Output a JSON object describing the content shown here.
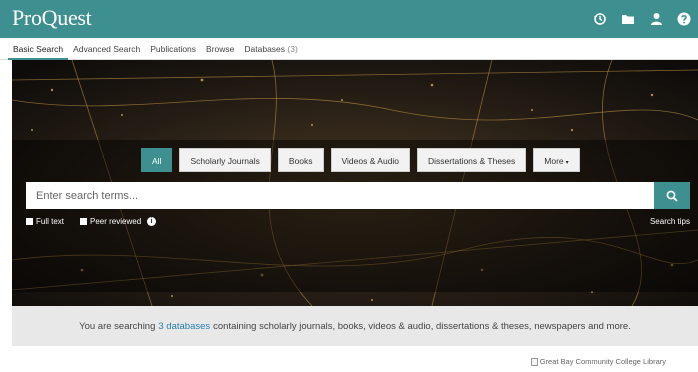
{
  "header": {
    "logo": "ProQuest",
    "icons": [
      "history-icon",
      "folder-icon",
      "user-icon",
      "help-icon"
    ]
  },
  "nav": {
    "tabs": [
      {
        "label": "Basic Search"
      },
      {
        "label": "Advanced Search"
      },
      {
        "label": "Publications"
      },
      {
        "label": "Browse"
      },
      {
        "label": "Databases",
        "count": "(3)"
      }
    ]
  },
  "filters": {
    "items": [
      "All",
      "Scholarly Journals",
      "Books",
      "Videos & Audio",
      "Dissertations & Theses",
      "More"
    ]
  },
  "search": {
    "placeholder": "Enter search terms...",
    "full_text": "Full text",
    "peer_reviewed": "Peer reviewed",
    "tips": "Search tips"
  },
  "info": {
    "prefix": "You are searching",
    "link": "3 databases",
    "suffix": "containing scholarly journals, books, videos & audio, dissertations & theses, newspapers and more."
  },
  "library": {
    "alt": "Great Bay Community College Library"
  },
  "colors": {
    "brand": "#3e8f8f",
    "link": "#2a7fb0"
  }
}
